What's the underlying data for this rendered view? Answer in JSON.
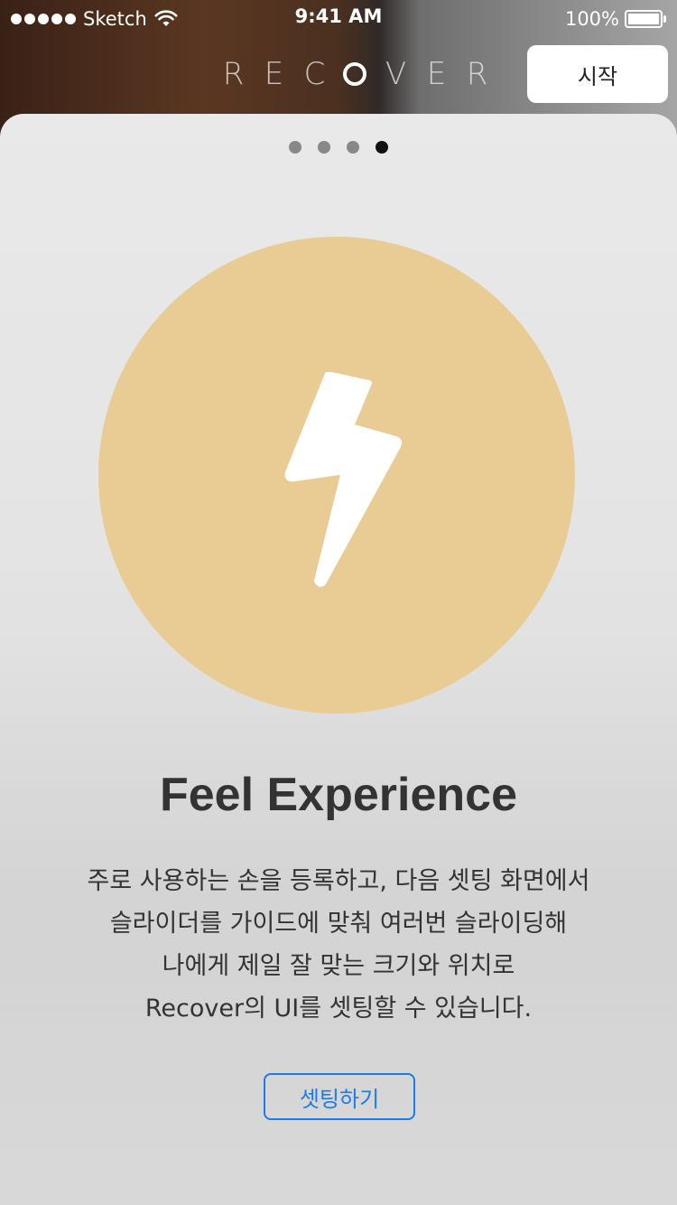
{
  "status_bar": {
    "carrier": "Sketch",
    "time": "9:41 AM",
    "battery": "100%",
    "battery_level": 1.0
  },
  "header": {
    "logo_letters": [
      "R",
      "E",
      "C",
      "O",
      "V",
      "E",
      "R"
    ],
    "start_button_label": "시작"
  },
  "onboarding": {
    "page_count": 4,
    "active_page": 4,
    "icon": "lightning-icon",
    "icon_circle_color": "#e8cc94",
    "title": "Feel Experience",
    "description_lines": [
      "주로 사용하는 손을 등록하고, 다음 셋팅 화면에서",
      "슬라이더를 가이드에 맞춰 여러번 슬라이딩해",
      "나에게 제일 잘 맞는 크기와 위치로",
      "Recover의 UI를 셋팅할 수 있습니다."
    ],
    "setup_button_label": "셋팅하기",
    "accent_color": "#1a7bea"
  }
}
